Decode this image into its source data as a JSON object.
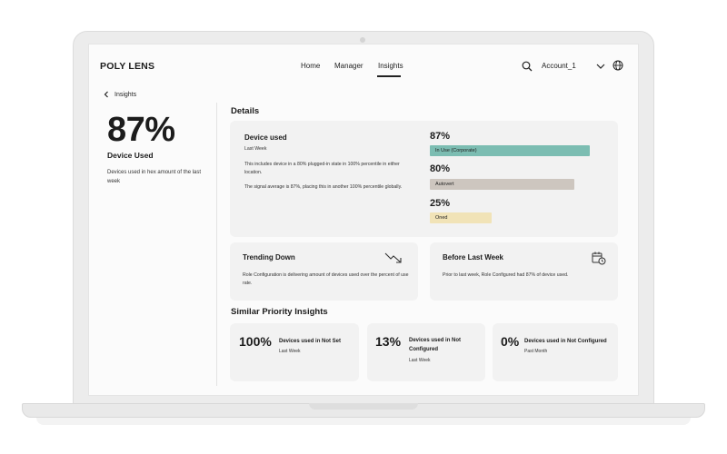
{
  "header": {
    "brand": "POLY LENS",
    "nav": [
      "Home",
      "Manager",
      "Insights"
    ],
    "active_nav": "Insights",
    "account": "Account_1",
    "icons": [
      "search-icon",
      "chevron-down-icon",
      "globe-icon"
    ]
  },
  "left_panel": {
    "back_label": "Insights",
    "big_value": "87%",
    "label": "Device Used",
    "description": "Devices used in hex amount of the last week"
  },
  "details": {
    "section_title": "Details",
    "card_title": "Device used",
    "card_subtitle": "Last Week",
    "desc1": "This includes device in a 80% plugged-in state in 100% percentile in either location.",
    "desc2": "The signal average is 87%, placing this in another 100% percentile globally.",
    "bars": [
      {
        "value": "87%",
        "label": "In Use (Corporate)",
        "color": "#7cbdb2"
      },
      {
        "value": "80%",
        "label": "Autovert",
        "color": "#cdc6bf"
      },
      {
        "value": "25%",
        "label": "Oned",
        "color": "#f1e3b7"
      }
    ]
  },
  "trending": {
    "title": "Trending Down",
    "description": "Role Configuration is delivering amount of devices used over the percent of use rate.",
    "icon": "trend-down-icon"
  },
  "before_last_week": {
    "title": "Before Last Week",
    "description": "Prior to last week, Role Configured had 87% of device used.",
    "icon": "calendar-clock-icon"
  },
  "similar": {
    "section_title": "Similar Priority Insights",
    "items": [
      {
        "value": "100%",
        "label": "Devices used in Not Set",
        "sub": "Last Week"
      },
      {
        "value": "13%",
        "label": "Devices used in Not Configured",
        "sub": "Last Week"
      },
      {
        "value": "0%",
        "label": "Devices used in Not Configured",
        "sub": "Past Month"
      }
    ]
  }
}
